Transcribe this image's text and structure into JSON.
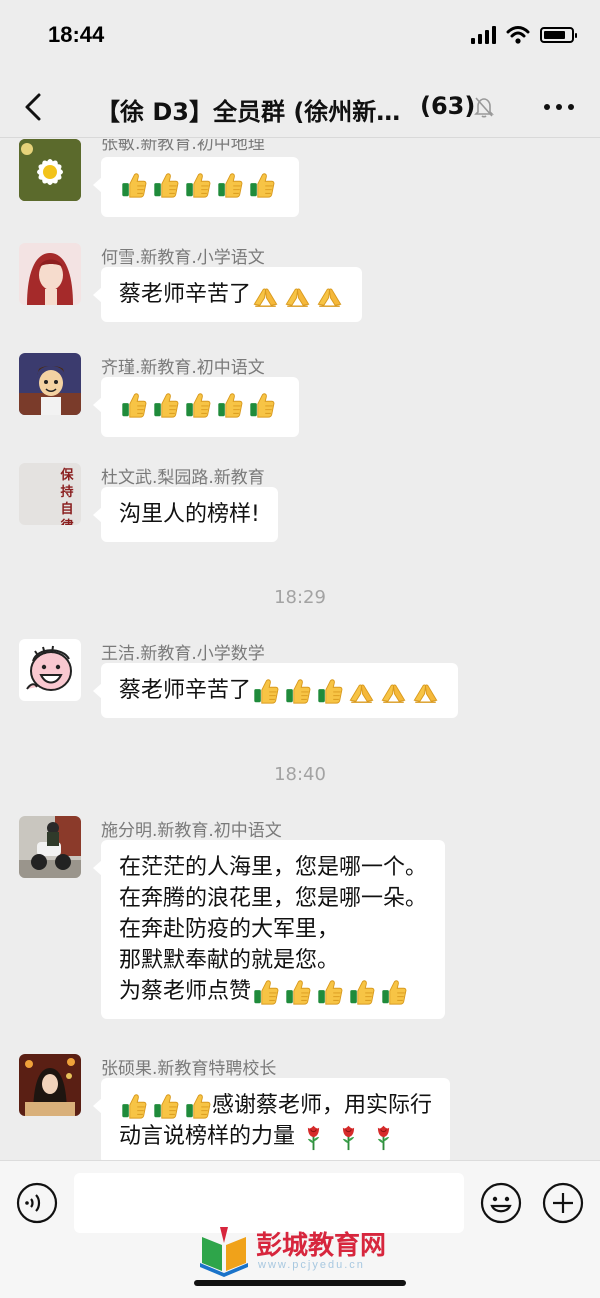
{
  "status_bar": {
    "time": "18:44"
  },
  "header": {
    "title": "【徐 D3】全员群 (徐州新…",
    "member_count": "(63)"
  },
  "messages": [
    {
      "sender": "张敏.新教育.初中地理",
      "lines": [],
      "emojis": [
        "thumbs-up",
        "thumbs-up",
        "thumbs-up",
        "thumbs-up",
        "thumbs-up"
      ]
    },
    {
      "sender": "何雪.新教育.小学语文",
      "lines": [
        "蔡老师辛苦了"
      ],
      "emojis": [
        "pray",
        "pray",
        "pray"
      ]
    },
    {
      "sender": "齐瑾.新教育.初中语文",
      "lines": [],
      "emojis": [
        "thumbs-up",
        "thumbs-up",
        "thumbs-up",
        "thumbs-up",
        "thumbs-up"
      ]
    },
    {
      "sender": "杜文武.梨园路.新教育",
      "lines": [
        "沟里人的榜样!"
      ],
      "avatar_text": "保持自律"
    },
    {
      "sender": "王洁.新教育.小学数学",
      "lines": [
        "蔡老师辛苦了"
      ],
      "emojis": [
        "thumbs-up",
        "thumbs-up",
        "thumbs-up",
        "pray",
        "pray",
        "pray"
      ]
    },
    {
      "sender": "施分明.新教育.初中语文",
      "lines": [
        "在茫茫的人海里，您是哪一个。",
        "在奔腾的浪花里，您是哪一朵。",
        "在奔赴防疫的大军里，",
        "那默默奉献的就是您。",
        "为蔡老师点赞"
      ],
      "emojis": [
        "thumbs-up",
        "thumbs-up",
        "thumbs-up",
        "thumbs-up",
        "thumbs-up"
      ]
    },
    {
      "sender": "张硕果.新教育特聘校长",
      "lines": [
        "感谢蔡老师，用实际行",
        "动言说榜样的力量"
      ],
      "emojis_lead": [
        "thumbs-up",
        "thumbs-up",
        "thumbs-up"
      ],
      "emojis": [
        "rose",
        "rose",
        "rose"
      ]
    }
  ],
  "timestamps": [
    "18:29",
    "18:40"
  ],
  "input_bar": {
    "placeholder": ""
  },
  "watermark": {
    "text": "彭城教育网",
    "url": "www.pcjyedu.cn"
  },
  "colors": {
    "background": "#ededed",
    "bubble": "#ffffff",
    "sender": "#7a7a7a",
    "watermark": "#d7263d"
  }
}
